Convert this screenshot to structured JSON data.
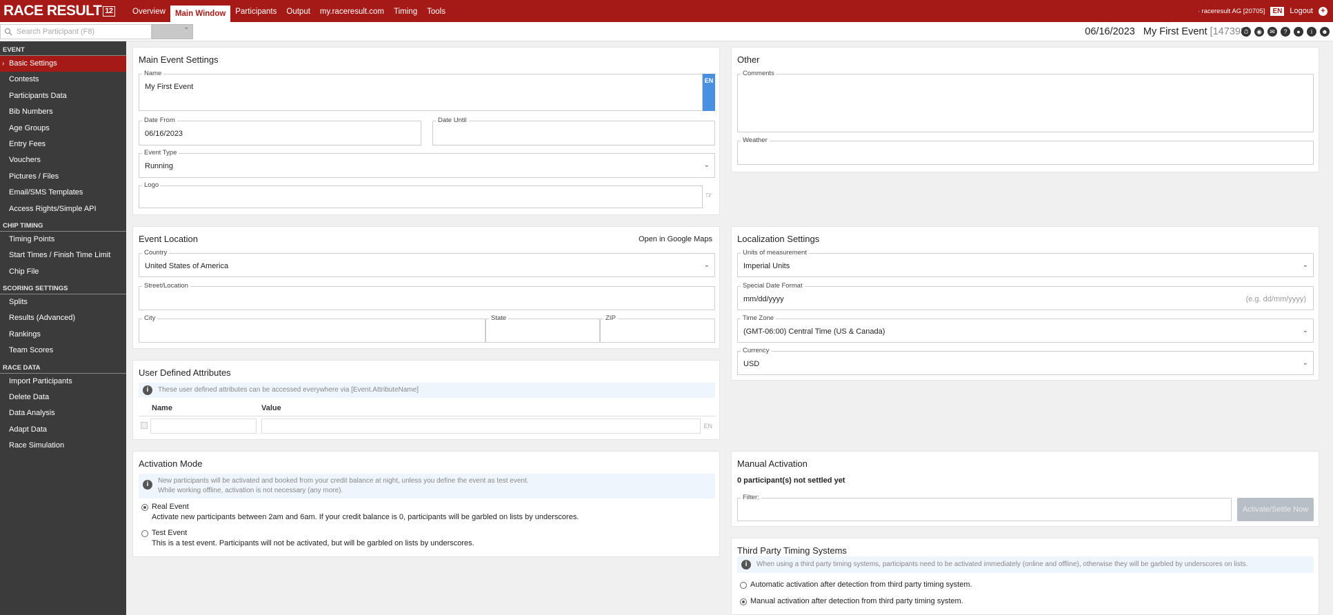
{
  "app": {
    "logo_text": "RACE RESULT",
    "logo_num": "12"
  },
  "topnav": {
    "items": [
      "Overview",
      "Main Window",
      "Participants",
      "Output",
      "my.raceresult.com",
      "Timing",
      "Tools"
    ],
    "active": "Main Window"
  },
  "topright": {
    "account": "· raceresult AG [20705]",
    "lang": "EN",
    "logout": "Logout"
  },
  "search": {
    "placeholder": "Search Participant (F8)"
  },
  "event": {
    "date": "06/16/2023",
    "name": "My First Event",
    "id": "[147398]"
  },
  "sidebar": {
    "sections": [
      {
        "title": "EVENT",
        "items": [
          "Basic Settings",
          "Contests",
          "Participants Data",
          "Bib Numbers",
          "Age Groups",
          "Entry Fees",
          "Vouchers",
          "Pictures / Files",
          "Email/SMS Templates",
          "Access Rights/Simple API"
        ]
      },
      {
        "title": "CHIP TIMING",
        "items": [
          "Timing Points",
          "Start Times / Finish Time Limit",
          "Chip File"
        ]
      },
      {
        "title": "SCORING SETTINGS",
        "items": [
          "Splits",
          "Results (Advanced)",
          "Rankings",
          "Team Scores"
        ]
      },
      {
        "title": "RACE DATA",
        "items": [
          "Import Participants",
          "Delete Data",
          "Data Analysis",
          "Adapt Data",
          "Race Simulation"
        ]
      }
    ],
    "active": "Basic Settings"
  },
  "main_settings": {
    "title": "Main Event Settings",
    "name_label": "Name",
    "name_value": "My First Event",
    "name_lang": "EN",
    "date_from_label": "Date From",
    "date_from_value": "06/16/2023",
    "date_until_label": "Date Until",
    "date_until_value": "",
    "event_type_label": "Event Type",
    "event_type_value": "Running",
    "logo_label": "Logo"
  },
  "other": {
    "title": "Other",
    "comments_label": "Comments",
    "weather_label": "Weather"
  },
  "location": {
    "title": "Event Location",
    "maps_link": "Open in Google Maps",
    "country_label": "Country",
    "country_value": "United States of America",
    "street_label": "Street/Location",
    "city_label": "City",
    "state_label": "State",
    "zip_label": "ZIP"
  },
  "localization": {
    "title": "Localization Settings",
    "units_label": "Units of measurement",
    "units_value": "Imperial Units",
    "date_format_label": "Special Date Format",
    "date_format_value": "mm/dd/yyyy",
    "date_format_hint": "(e.g. dd/mm/yyyy)",
    "timezone_label": "Time Zone",
    "timezone_value": "(GMT-06:00) Central Time (US & Canada)",
    "currency_label": "Currency",
    "currency_value": "USD"
  },
  "user_attrs": {
    "title": "User Defined Attributes",
    "info": "These user defined attributes can be accessed everywhere via [Event.AttributeName]",
    "col_name": "Name",
    "col_value": "Value",
    "lang": "EN"
  },
  "activation_mode": {
    "title": "Activation Mode",
    "info_line1": "New participants will be activated and booked from your credit balance at night, unless you define the event as test event.",
    "info_line2": "While working offline, activation is not necessary (any more).",
    "real_title": "Real Event",
    "real_desc": "Activate new participants between 2am and 6am. If your credit balance is 0, participants will be garbled on lists by underscores.",
    "test_title": "Test Event",
    "test_desc": "This is a test event. Participants will not be activated, but will be garbled on lists by underscores.",
    "selected": "Real Event"
  },
  "manual_activation": {
    "title": "Manual Activation",
    "status": "0 participant(s) not settled yet",
    "filter_label": "Filter:",
    "button": "Activate/Settle Now"
  },
  "third_party": {
    "title": "Third Party Timing Systems",
    "info": "When using a third party timing systems, participants need to be activated immediately (online and offline), otherwise they will be garbled by underscores on lists.",
    "option_auto": "Automatic activation after detection from third party timing system.",
    "option_manual": "Manual activation after detection from third party timing system.",
    "selected": "Manual"
  }
}
